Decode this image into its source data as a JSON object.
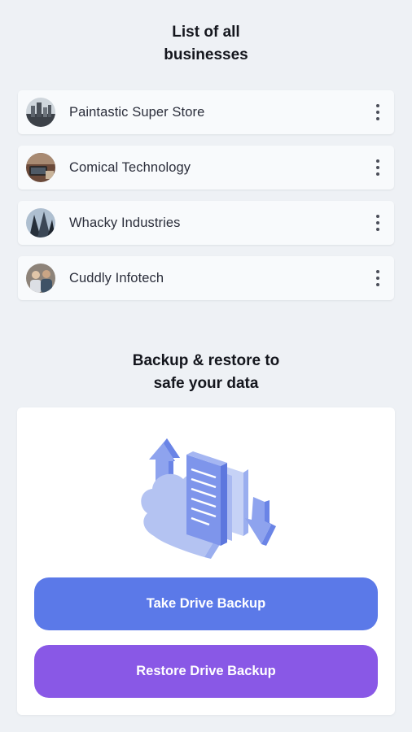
{
  "businesses_section": {
    "title_line1": "List of all",
    "title_line2": "businesses",
    "items": [
      {
        "name": "Paintastic Super Store",
        "avatar": "city-skyline-photo"
      },
      {
        "name": "Comical Technology",
        "avatar": "desk-laptop-photo"
      },
      {
        "name": "Whacky Industries",
        "avatar": "skyscraper-photo"
      },
      {
        "name": "Cuddly Infotech",
        "avatar": "team-photo"
      }
    ],
    "menu_icon": "more-vertical-icon"
  },
  "backup_section": {
    "title_line1": "Backup & restore to",
    "title_line2": "safe your data",
    "illustration": "cloud-documents-sync-illustration",
    "take_backup_label": "Take Drive Backup",
    "restore_backup_label": "Restore Drive Backup"
  },
  "colors": {
    "background": "#eef1f5",
    "take_button": "#5b79e8",
    "restore_button": "#8958e6",
    "illustration_light": "#b4c3f2",
    "illustration_dark": "#6a84e6"
  }
}
